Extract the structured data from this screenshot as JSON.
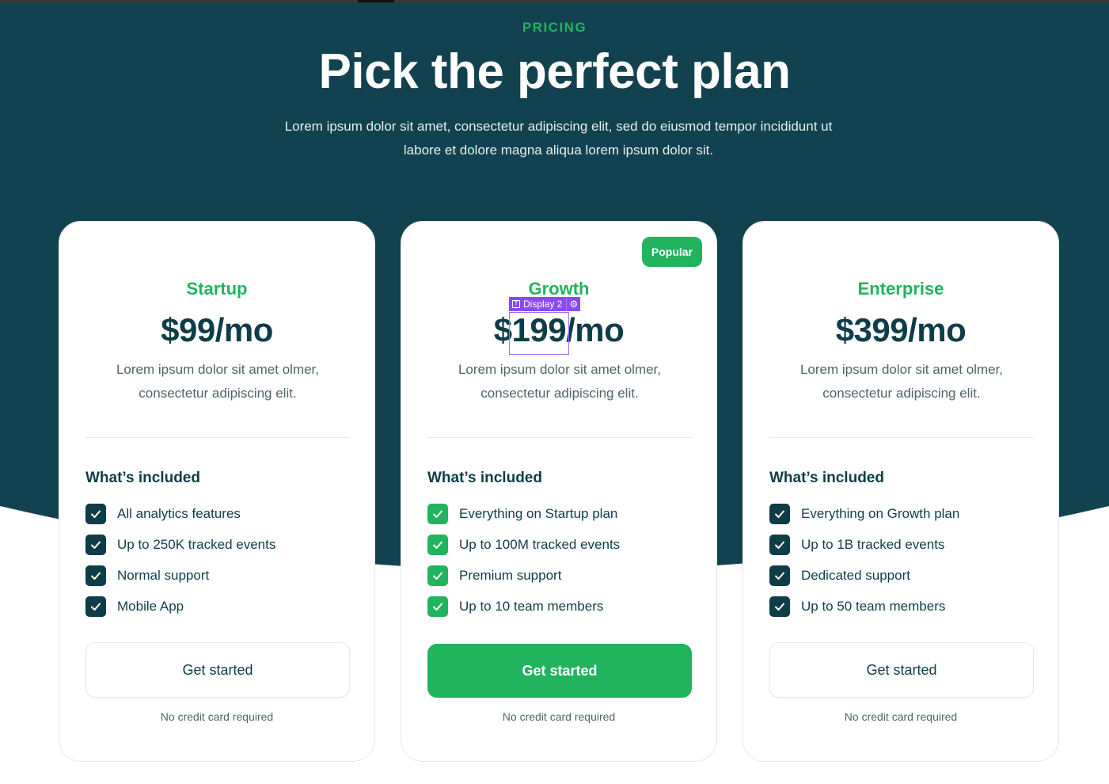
{
  "colors": {
    "hero_bg": "#12424f",
    "accent_green": "#22b35e",
    "dark_text": "#0f3d47",
    "editor_purple": "#8a4af3"
  },
  "hero": {
    "eyebrow": "PRICING",
    "title": "Pick the perfect plan",
    "subtitle": "Lorem ipsum dolor sit amet, consectetur adipiscing elit, sed do eiusmod tempor incididunt ut labore et dolore magna aliqua lorem ipsum dolor sit."
  },
  "plans": [
    {
      "name": "Startup",
      "price_currency": "$",
      "price_amount": "99",
      "price_period": "/mo",
      "description": "Lorem ipsum dolor sit amet olmer, consectetur adipiscing elit.",
      "included_title": "What’s included",
      "features": [
        "All analytics features",
        "Up to 250K tracked events",
        "Normal support",
        "Mobile App"
      ],
      "cta": "Get started",
      "note": "No credit card required"
    },
    {
      "name": "Growth",
      "badge": "Popular",
      "price_currency": "$",
      "price_amount": "199",
      "price_period": "/mo",
      "description": "Lorem ipsum dolor sit amet olmer, consectetur adipiscing elit.",
      "included_title": "What’s included",
      "features": [
        "Everything on Startup plan",
        "Up to 100M tracked events",
        "Premium support",
        "Up to 10 team members"
      ],
      "cta": "Get started",
      "note": "No credit card required"
    },
    {
      "name": "Enterprise",
      "price_currency": "$",
      "price_amount": "399",
      "price_period": "/mo",
      "description": "Lorem ipsum dolor sit amet olmer, consectetur adipiscing elit.",
      "included_title": "What’s included",
      "features": [
        "Everything on Growth plan",
        "Up to 1B tracked events",
        "Dedicated support",
        "Up to 50 team members"
      ],
      "cta": "Get started",
      "note": "No credit card required"
    }
  ],
  "editor_overlay": {
    "label": "Display 2",
    "type_icon": "text-icon",
    "settings_icon": "gear-icon"
  }
}
